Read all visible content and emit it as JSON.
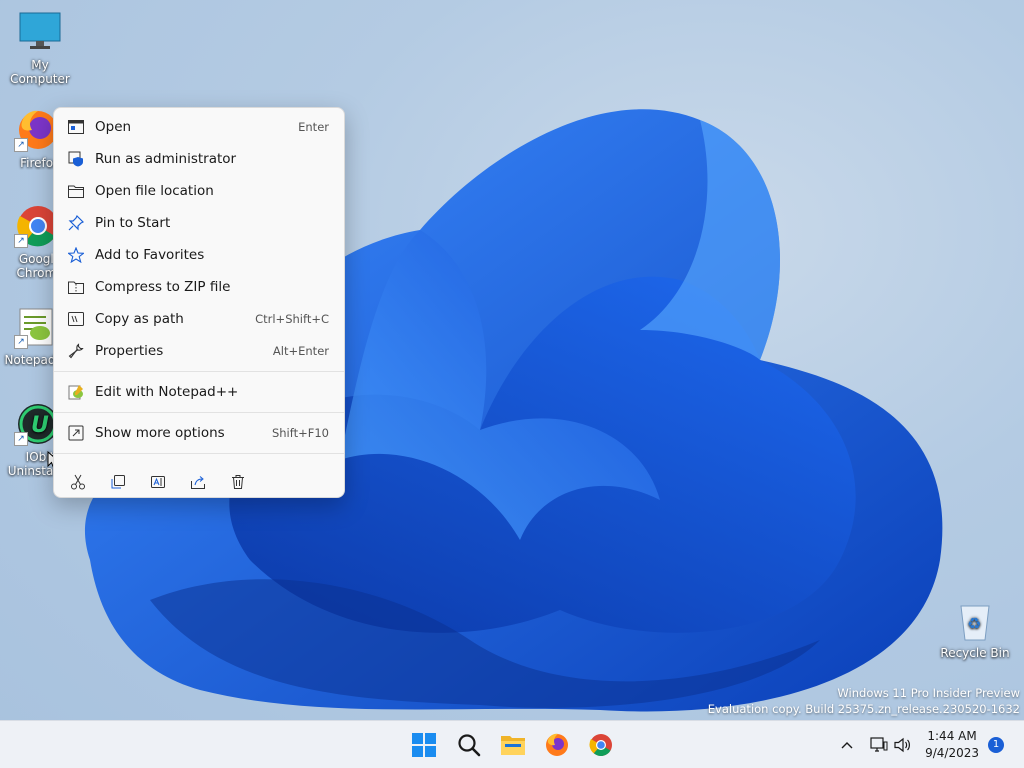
{
  "desktop": {
    "icons": [
      {
        "label": "My Computer"
      },
      {
        "label": "Firefox"
      },
      {
        "label": "Google Chrome"
      },
      {
        "label": "Notepad++"
      },
      {
        "label": "IObit Uninstaller"
      },
      {
        "label": "Recycle Bin"
      }
    ]
  },
  "context_menu": {
    "items": [
      {
        "label": "Open",
        "shortcut": "Enter",
        "icon": "open-icon"
      },
      {
        "label": "Run as administrator",
        "shortcut": "",
        "icon": "shield-icon"
      },
      {
        "label": "Open file location",
        "shortcut": "",
        "icon": "folder-icon"
      },
      {
        "label": "Pin to Start",
        "shortcut": "",
        "icon": "pin-icon"
      },
      {
        "label": "Add to Favorites",
        "shortcut": "",
        "icon": "star-icon"
      },
      {
        "label": "Compress to ZIP file",
        "shortcut": "",
        "icon": "zip-icon"
      },
      {
        "label": "Copy as path",
        "shortcut": "Ctrl+Shift+C",
        "icon": "copy-path-icon"
      },
      {
        "label": "Properties",
        "shortcut": "Alt+Enter",
        "icon": "wrench-icon"
      },
      {
        "label": "Edit with Notepad++",
        "shortcut": "",
        "icon": "notepadpp-icon"
      },
      {
        "label": "Show more options",
        "shortcut": "Shift+F10",
        "icon": "more-options-icon"
      }
    ],
    "quick_actions": [
      "cut-icon",
      "copy-icon",
      "rename-icon",
      "share-icon",
      "delete-icon"
    ]
  },
  "watermark": {
    "line1": "Windows 11 Pro Insider Preview",
    "line2": "Evaluation copy. Build 25375.zn_release.230520-1632"
  },
  "taskbar": {
    "clock_time": "1:44 AM",
    "clock_date": "9/4/2023",
    "notification_count": "1"
  },
  "colors": {
    "accent": "#1a5fd6",
    "menu_bg": "#f9f9f9",
    "taskbar_bg": "#eef1f6"
  }
}
